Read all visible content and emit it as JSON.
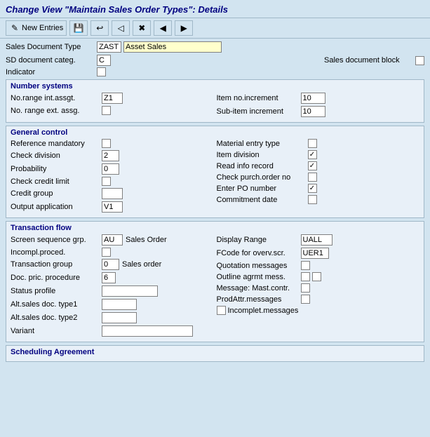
{
  "title": "Change View \"Maintain Sales Order Types\": Details",
  "toolbar": {
    "new_entries_label": "New Entries",
    "icons": [
      "new-entries-icon",
      "save-icon",
      "discard-icon",
      "back-icon",
      "exit-icon",
      "next-icon",
      "prev-icon"
    ]
  },
  "top_form": {
    "sales_doc_type_label": "Sales Document Type",
    "sales_doc_type_code": "ZAST",
    "sales_doc_type_value": "Asset Sales",
    "sd_doc_categ_label": "SD document categ.",
    "sd_doc_categ_value": "C",
    "sales_doc_block_label": "Sales document block",
    "indicator_label": "Indicator"
  },
  "number_systems": {
    "title": "Number systems",
    "no_range_int_label": "No.range int.assgt.",
    "no_range_int_value": "Z1",
    "no_range_ext_label": "No. range ext. assg.",
    "no_range_ext_value": "",
    "item_no_incr_label": "Item no.increment",
    "item_no_incr_value": "10",
    "sub_item_incr_label": "Sub-item increment",
    "sub_item_incr_value": "10"
  },
  "general_control": {
    "title": "General control",
    "ref_mandatory_label": "Reference mandatory",
    "ref_mandatory_checked": false,
    "check_division_label": "Check division",
    "check_division_value": "2",
    "probability_label": "Probability",
    "probability_value": "0",
    "check_credit_label": "Check credit limit",
    "check_credit_checked": false,
    "credit_group_label": "Credit group",
    "credit_group_value": "",
    "output_app_label": "Output application",
    "output_app_value": "V1",
    "material_entry_label": "Material entry type",
    "material_entry_checked": false,
    "item_division_label": "Item division",
    "item_division_checked": true,
    "read_info_label": "Read info record",
    "read_info_checked": true,
    "check_purch_label": "Check purch.order no",
    "check_purch_checked": false,
    "enter_po_label": "Enter PO number",
    "enter_po_checked": true,
    "commitment_date_label": "Commitment  date",
    "commitment_date_checked": false
  },
  "transaction_flow": {
    "title": "Transaction flow",
    "screen_seq_label": "Screen sequence grp.",
    "screen_seq_value": "AU",
    "screen_seq_text": "Sales Order",
    "incompl_proced_label": "Incompl.proced.",
    "incompl_proced_checked": false,
    "trans_group_label": "Transaction group",
    "trans_group_value": "0",
    "trans_group_text": "Sales order",
    "doc_pric_label": "Doc. pric. procedure",
    "doc_pric_value": "6",
    "status_profile_label": "Status profile",
    "status_profile_value": "",
    "alt_sales1_label": "Alt.sales doc. type1",
    "alt_sales1_value": "",
    "alt_sales2_label": "Alt.sales doc. type2",
    "alt_sales2_value": "",
    "variant_label": "Variant",
    "variant_value": "",
    "display_range_label": "Display Range",
    "display_range_value": "UALL",
    "fcode_label": "FCode for overv.scr.",
    "fcode_value": "UER1",
    "quotation_msg_label": "Quotation messages",
    "quotation_msg_checked": false,
    "outline_agrmt_label": "Outline agrmt mess.",
    "outline_agrmt_checked": false,
    "outline_agrmt_checked2": false,
    "message_mast_label": "Message: Mast.contr.",
    "message_mast_checked": false,
    "prodattr_label": "ProdAttr.messages",
    "prodattr_checked": false,
    "incomplet_msg_label": "Incomplet.messages",
    "incomplet_msg_checked": false
  },
  "scheduling": {
    "title": "Scheduling Agreement"
  }
}
